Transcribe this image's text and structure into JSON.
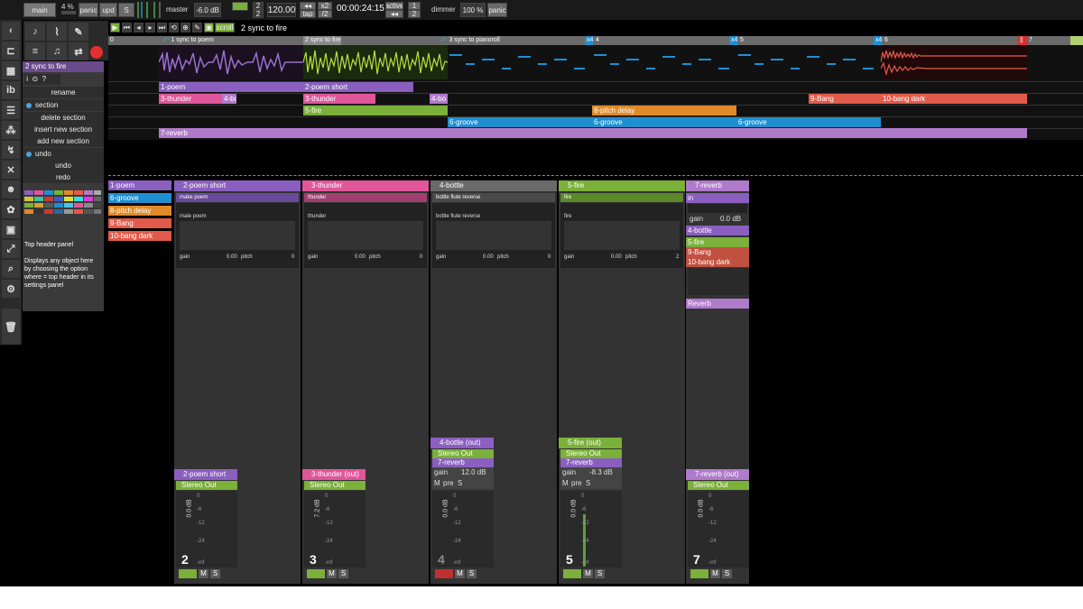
{
  "topbar": {
    "main": "main",
    "cpu": "4 %",
    "panic": "panic",
    "upd": "upd",
    "s": "S",
    "master": "master",
    "master_db": "-6.0 dB",
    "meter_top": "2",
    "meter_bot": "2",
    "tempo": "120.00",
    "tempo_half": "x2",
    "tap": "tap",
    "tempo_div": "/2",
    "time": "00:00:24:15",
    "active": "active",
    "active_top": "1",
    "active_bot": "2",
    "dimmer": "dimmer",
    "dimmer_val": "100 %",
    "panic2": "panic"
  },
  "transport": {
    "scroll": "scroll",
    "section_title": "2 sync to fire"
  },
  "ruler": {
    "marks": [
      "0",
      "1 sync to poem",
      "2 sync to fire",
      "3 sync to pianoroll",
      "x4",
      "4",
      "x4",
      "5",
      "x4",
      "6",
      "7"
    ]
  },
  "clips": {
    "poem": "1-poem",
    "poem_short": "2-poem short",
    "thunder": "3-thunder",
    "thunder2": "3-thunder",
    "bo": "4-bo",
    "bo2": "4-bo",
    "fire": "5-fire",
    "pitch": "8-pitch delay",
    "groove1": "6-groove",
    "groove2": "6-groove",
    "groove3": "6-groove",
    "bang": "9-Bang",
    "bang_dark": "10-bang dark",
    "reverb": "7-reverb"
  },
  "leftpanel": {
    "title": "2 sync to fire",
    "rename": "rename",
    "section": "section",
    "delete_section": "delete section",
    "insert_section": "insert new section",
    "add_section": "add new section",
    "undo_head": "undo",
    "undo": "undo",
    "redo": "redo",
    "help_title": "Top header panel",
    "help_text": "Displays any object here by choosing the option where = top header in its settings panel"
  },
  "tracklist": [
    "1-poem",
    "6-groove",
    "8-pitch delay",
    "9-Bang",
    "10-bang dark"
  ],
  "strips": [
    {
      "name": "2-poem short",
      "device": "make poem",
      "sample": "male poem",
      "gain": "gain",
      "gain_val": "0.00",
      "pitch": "pitch",
      "pitch_val": "0",
      "out": "2-poem short (out)",
      "stereo": "Stereo Out",
      "db": "0.0 dB",
      "num": "2"
    },
    {
      "name": "3-thunder",
      "device": "thunder",
      "sample": "thunder",
      "gain": "gain",
      "gain_val": "0.00",
      "pitch": "pitch",
      "pitch_val": "0",
      "out": "3-thunder (out)",
      "stereo": "Stereo Out",
      "db": "7.2 dB",
      "num": "3"
    },
    {
      "name": "4-bottle",
      "device": "bottle flute reverse",
      "sample": "bottle flute reverse",
      "gain": "gain",
      "gain_val": "0.00",
      "pitch": "pitch",
      "pitch_val": "0",
      "out": "4-bottle (out)",
      "stereo": "Stereo Out",
      "send": "7-reverb",
      "send_gain": "gain",
      "send_val": "12.0 dB",
      "m": "M",
      "pre": "pre",
      "s": "S",
      "db": "0.0 dB",
      "num": "4"
    },
    {
      "name": "5-fire",
      "device": "fire",
      "sample": "fire",
      "gain": "gain",
      "gain_val": "0.00",
      "pitch": "pitch",
      "pitch_val": "2",
      "out": "5-fire (out)",
      "stereo": "Stereo Out",
      "send": "7-reverb",
      "send_gain": "gain",
      "send_val": "-8.3 dB",
      "m": "M",
      "pre": "pre",
      "s": "S",
      "db": "0.0 dB",
      "num": "5"
    }
  ],
  "reverb_strip": {
    "name": "7-reverb",
    "in": "in",
    "gain": "gain",
    "gain_val": "0.0 dB",
    "sends": [
      "4-bottle",
      "5-fire",
      "9-Bang",
      "10-bang dark"
    ],
    "reverb": "Reverb",
    "out": "7-reverb (out)",
    "stereo": "Stereo Out",
    "db": "0.0 dB",
    "num": "7"
  },
  "scale": [
    "0",
    "-6",
    "-12",
    "-24",
    "-inf"
  ],
  "colors": {
    "purple": "#8a5fbf",
    "pink": "#e0569a",
    "green": "#7bb03a",
    "blue": "#1f8fd0",
    "orange": "#e08a2a",
    "salmon": "#e25b4a",
    "violet": "#b07acb"
  }
}
